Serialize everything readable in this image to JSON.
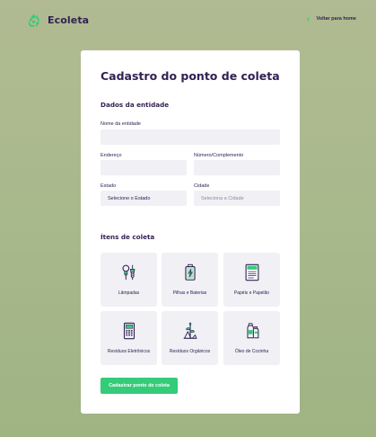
{
  "header": {
    "logo_text": "Ecoleta",
    "back_link": "Voltar para home"
  },
  "form": {
    "title": "Cadastro do ponto de coleta",
    "entity_section": "Dados da entidade",
    "fields": {
      "name_label": "Nome da entidade",
      "name_value": "",
      "address_label": "Endereço",
      "address_value": "",
      "number_label": "Número/Complemento",
      "number_value": "",
      "state_label": "Estado",
      "state_value": "Selecione o Estado",
      "city_label": "Cidade",
      "city_value": "Seleciona a Cidade"
    },
    "items_section": "Ítens de coleta",
    "items": [
      {
        "label": "Lâmpadas",
        "icon": "lamps-icon"
      },
      {
        "label": "Pilhas e Baterias",
        "icon": "battery-icon"
      },
      {
        "label": "Papéis e Papelão",
        "icon": "paper-icon"
      },
      {
        "label": "Resíduos Eletrônicos",
        "icon": "electronics-icon"
      },
      {
        "label": "Resíduos Orgânicos",
        "icon": "organic-icon"
      },
      {
        "label": "Óleo de Cozinha",
        "icon": "oil-icon"
      }
    ],
    "submit_label": "Cadastrar ponto de coleta"
  },
  "colors": {
    "primary": "#34cb79",
    "title": "#322153",
    "input_bg": "#f0f0f5",
    "background": "#a8b98c"
  }
}
